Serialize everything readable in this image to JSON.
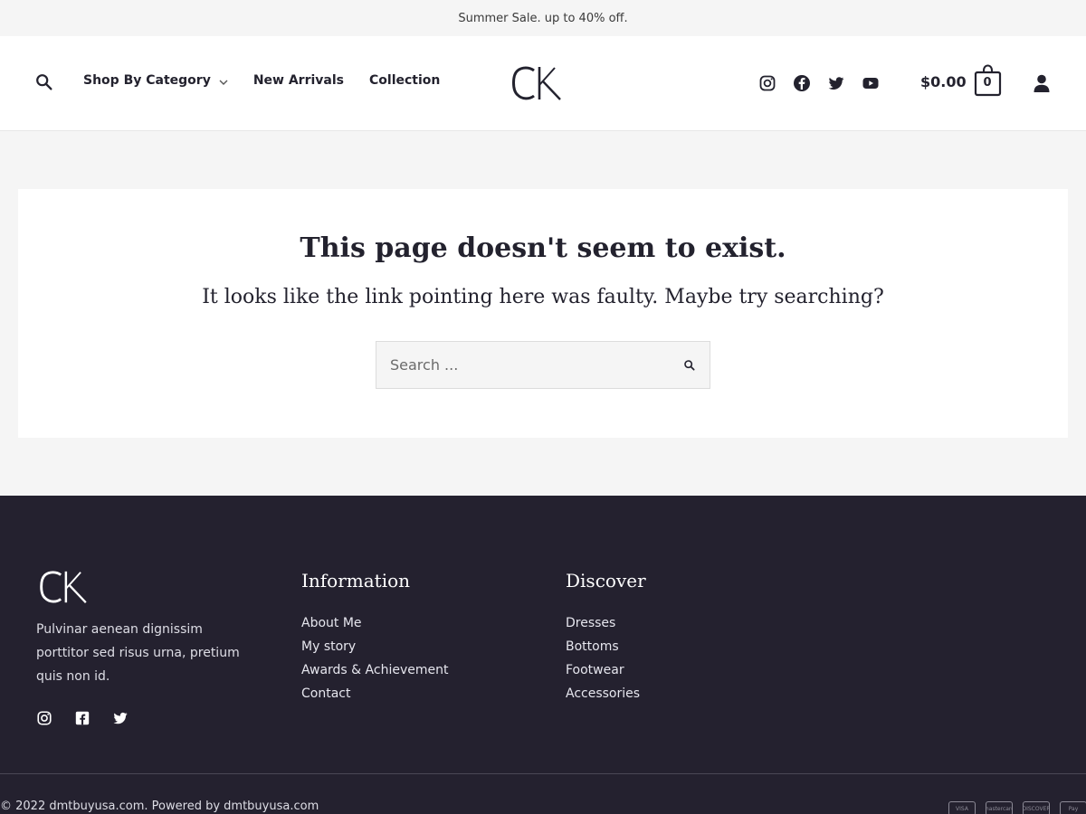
{
  "announcement": {
    "text": "Summer Sale. up to 40% off."
  },
  "header": {
    "nav": [
      {
        "label": "Shop By Category",
        "has_dropdown": true
      },
      {
        "label": "New Arrivals"
      },
      {
        "label": "Collection"
      }
    ],
    "logo_icon": "ck-logo",
    "social_icons": [
      "instagram-icon",
      "facebook-icon",
      "twitter-icon",
      "youtube-icon"
    ],
    "cart": {
      "total": "$0.00",
      "count": "0"
    }
  },
  "main": {
    "title": "This page doesn't seem to exist.",
    "subtitle": "It looks like the link pointing here was faulty. Maybe try searching?",
    "search": {
      "placeholder": "Search ...",
      "value": ""
    }
  },
  "footer": {
    "description": "Pulvinar aenean dignissim porttitor sed risus urna, pretium quis non id.",
    "social_icons": [
      "instagram-icon",
      "facebook-square-icon",
      "twitter-icon"
    ],
    "columns": [
      {
        "heading": "Information",
        "links": [
          "About Me",
          "My story",
          "Awards & Achievement",
          "Contact"
        ]
      },
      {
        "heading": "Discover",
        "links": [
          "Dresses",
          "Bottoms",
          "Footwear",
          "Accessories"
        ]
      }
    ],
    "copyright": "© 2022 dmtbuyusa.com. Powered by dmtbuyusa.com",
    "payments": [
      "VISA",
      "mastercard",
      "DISCOVER",
      "Pay"
    ]
  },
  "colors": {
    "dark": "#24212f",
    "text": "#23222e",
    "page_bg": "#f5f5f5"
  }
}
